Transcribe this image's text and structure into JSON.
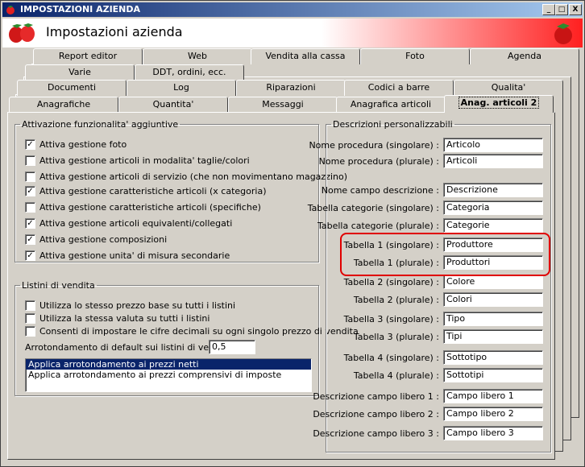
{
  "window": {
    "title": "IMPOSTAZIONI AZIENDA",
    "minimize": "_",
    "maximize": "□",
    "close": "X"
  },
  "header": {
    "title": "Impostazioni azienda"
  },
  "tabs": {
    "row1": [
      "Report editor",
      "Web",
      "Vendita alla cassa",
      "Foto",
      "Agenda"
    ],
    "row2": [
      "Varie",
      "DDT, ordini, ecc."
    ],
    "row3": [
      "Documenti",
      "Log",
      "Riparazioni",
      "Codici a barre",
      "Qualita'"
    ],
    "row4": [
      "Anagrafiche",
      "Quantita'",
      "Messaggi",
      "Anagrafica articoli",
      "Anag. articoli 2"
    ]
  },
  "attivazione": {
    "legend": "Attivazione funzionalita' aggiuntive",
    "items": [
      {
        "label": "Attiva gestione foto",
        "checked": true
      },
      {
        "label": "Attiva gestione articoli in modalita' taglie/colori",
        "checked": false
      },
      {
        "label": "Attiva gestione articoli di servizio (che non movimentano magazzino)",
        "checked": false
      },
      {
        "label": "Attiva gestione caratteristiche articoli (x categoria)",
        "checked": true
      },
      {
        "label": "Attiva gestione caratteristiche articoli (specifiche)",
        "checked": false
      },
      {
        "label": "Attiva gestione articoli equivalenti/collegati",
        "checked": true
      },
      {
        "label": "Attiva gestione composizioni",
        "checked": true
      },
      {
        "label": "Attiva gestione unita' di misura secondarie",
        "checked": true
      }
    ]
  },
  "listini": {
    "legend": "Listini di vendita",
    "items": [
      {
        "label": "Utilizza lo stesso prezzo base su tutti i listini",
        "checked": false
      },
      {
        "label": "Utilizza la stessa valuta su tutti i listini",
        "checked": false
      },
      {
        "label": "Consenti di impostare le cifre decimali su ogni singolo prezzo di vendita",
        "checked": false
      }
    ],
    "rounding_label": "Arrotondamento di default sui listini di vendita :",
    "rounding_value": "0,5",
    "options": [
      "Applica arrotondamento ai prezzi netti",
      "Applica arrotondamento ai prezzi comprensivi di imposte"
    ]
  },
  "descrizioni": {
    "legend": "Descrizioni personalizzabili",
    "rows": [
      {
        "label": "Nome procedura (singolare) :",
        "value": "Articolo"
      },
      {
        "label": "Nome procedura (plurale) :",
        "value": "Articoli"
      },
      {
        "label": "Nome campo descrizione :",
        "value": "Descrizione"
      },
      {
        "label": "Tabella categorie (singolare) :",
        "value": "Categoria"
      },
      {
        "label": "Tabella categorie (plurale) :",
        "value": "Categorie"
      },
      {
        "label": "Tabella 1 (singolare) :",
        "value": "Produttore"
      },
      {
        "label": "Tabella 1 (plurale) :",
        "value": "Produttori"
      },
      {
        "label": "Tabella 2 (singolare) :",
        "value": "Colore"
      },
      {
        "label": "Tabella 2 (plurale) :",
        "value": "Colori"
      },
      {
        "label": "Tabella 3 (singolare) :",
        "value": "Tipo"
      },
      {
        "label": "Tabella 3 (plurale) :",
        "value": "Tipi"
      },
      {
        "label": "Tabella 4 (singolare) :",
        "value": "Sottotipo"
      },
      {
        "label": "Tabella 4 (plurale) :",
        "value": "Sottotipi"
      },
      {
        "label": "Descrizione campo libero 1 :",
        "value": "Campo libero 1"
      },
      {
        "label": "Descrizione campo libero 2 :",
        "value": "Campo libero 2"
      },
      {
        "label": "Descrizione campo libero 3 :",
        "value": "Campo libero 3"
      }
    ]
  }
}
